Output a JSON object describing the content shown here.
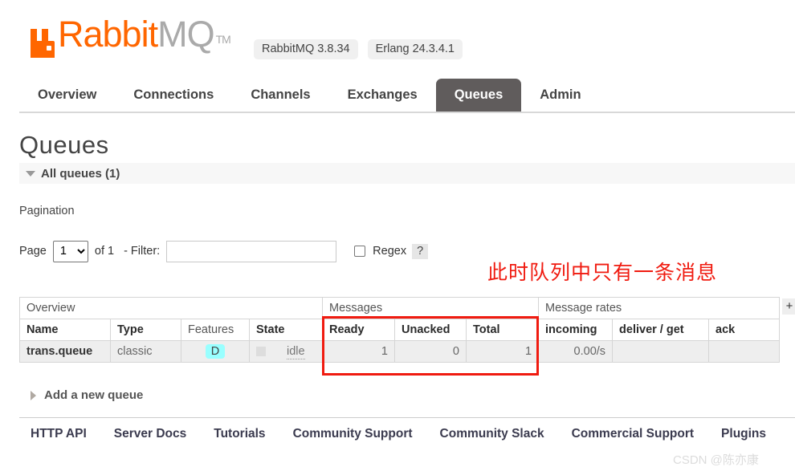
{
  "header": {
    "logo_rabbit": "Rabbit",
    "logo_mq": "MQ",
    "logo_tm": "TM",
    "logo_icon": "rabbitmq-logo-icon",
    "badges": [
      {
        "label": "RabbitMQ 3.8.34"
      },
      {
        "label": "Erlang 24.3.4.1"
      }
    ]
  },
  "nav": {
    "tabs": [
      {
        "label": "Overview",
        "active": false
      },
      {
        "label": "Connections",
        "active": false
      },
      {
        "label": "Channels",
        "active": false
      },
      {
        "label": "Exchanges",
        "active": false
      },
      {
        "label": "Queues",
        "active": true
      },
      {
        "label": "Admin",
        "active": false
      }
    ]
  },
  "page": {
    "title": "Queues",
    "all_queues_label": "All queues (1)",
    "pagination_label": "Pagination"
  },
  "controls": {
    "page_label": "Page",
    "page_value": "1",
    "page_options": [
      "1"
    ],
    "of_label": "of 1",
    "filter_label": "- Filter:",
    "filter_value": "",
    "filter_placeholder": "",
    "regex_label": "Regex",
    "regex_help": "?",
    "regex_checked": false
  },
  "annotation": {
    "text": "此时队列中只有一条消息",
    "color": "#f01b10"
  },
  "table": {
    "groups": [
      {
        "label": "Overview",
        "span": 4
      },
      {
        "label": "Messages",
        "span": 3
      },
      {
        "label": "Message rates",
        "span": 3
      }
    ],
    "columns": [
      {
        "label": "Name",
        "bold": true
      },
      {
        "label": "Type",
        "bold": true
      },
      {
        "label": "Features",
        "bold": false
      },
      {
        "label": "State",
        "bold": true
      },
      {
        "label": "Ready",
        "bold": true
      },
      {
        "label": "Unacked",
        "bold": true
      },
      {
        "label": "Total",
        "bold": true
      },
      {
        "label": "incoming",
        "bold": true
      },
      {
        "label": "deliver / get",
        "bold": true
      },
      {
        "label": "ack",
        "bold": true
      }
    ],
    "rows": [
      {
        "name": "trans.queue",
        "type": "classic",
        "features": "D",
        "state": "idle",
        "ready": "1",
        "unacked": "0",
        "total": "1",
        "incoming": "0.00/s",
        "deliver_get": "",
        "ack": ""
      }
    ],
    "column_toggle": "+"
  },
  "add_queue": {
    "label": "Add a new queue"
  },
  "footer": {
    "links": [
      {
        "label": "HTTP API"
      },
      {
        "label": "Server Docs"
      },
      {
        "label": "Tutorials"
      },
      {
        "label": "Community Support"
      },
      {
        "label": "Community Slack"
      },
      {
        "label": "Commercial Support"
      },
      {
        "label": "Plugins"
      }
    ]
  },
  "watermark": {
    "text": "CSDN @陈亦康"
  }
}
